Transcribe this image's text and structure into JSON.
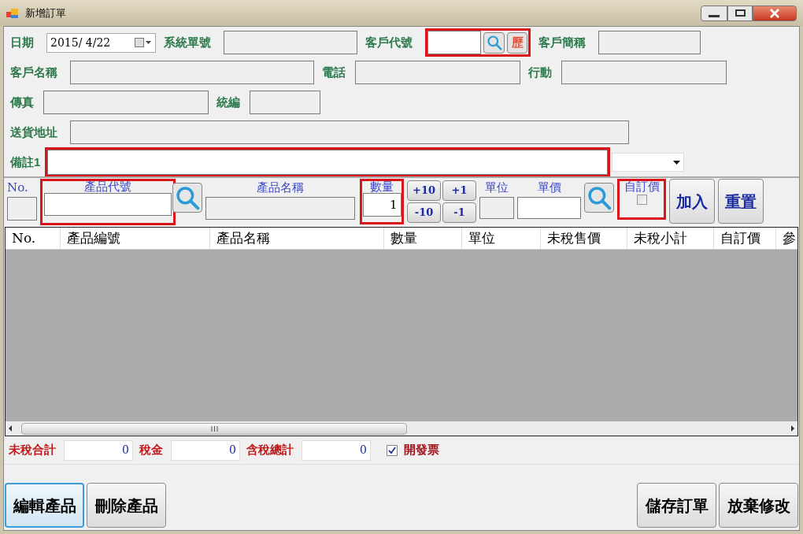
{
  "window": {
    "title": "新增訂單"
  },
  "form_rows": [
    [
      {
        "kind": "date",
        "label": "日期",
        "value": "2015/ 4/22"
      },
      {
        "kind": "field",
        "label": "系統單號",
        "readonly": true,
        "highlighted": false
      },
      {
        "kind": "lookup",
        "label": "客戶代號",
        "history_button": "歷",
        "readonly": false,
        "highlighted": true
      },
      {
        "kind": "field",
        "label": "客戶簡稱",
        "readonly": true,
        "highlighted": false
      }
    ],
    [
      {
        "kind": "field",
        "label": "客戶名稱",
        "readonly": true,
        "highlighted": false
      },
      {
        "kind": "field",
        "label": "電話",
        "readonly": true,
        "highlighted": false
      },
      {
        "kind": "field",
        "label": "行動",
        "readonly": true,
        "highlighted": false
      }
    ],
    [
      {
        "kind": "field",
        "label": "傳真",
        "readonly": true,
        "highlighted": false
      },
      {
        "kind": "field",
        "label": "統編",
        "readonly": true,
        "highlighted": false
      }
    ],
    [
      {
        "kind": "field",
        "label": "送貨地址",
        "readonly": true,
        "highlighted": false
      }
    ],
    [
      {
        "kind": "memo",
        "label": "備註1",
        "readonly": false,
        "highlighted": true
      }
    ]
  ],
  "entry": {
    "no_label": "No.",
    "code": {
      "label": "產品代號",
      "highlighted": true
    },
    "name": {
      "label": "產品名稱"
    },
    "qty": {
      "label": "數量",
      "value": "1",
      "highlighted": true
    },
    "steps": [
      "+10",
      "+1",
      "-10",
      "-1"
    ],
    "unit": {
      "label": "單位"
    },
    "price": {
      "label": "單價"
    },
    "custom_price": {
      "label": "自訂價",
      "checked": false,
      "highlighted": true
    },
    "buttons": [
      "加入",
      "重置"
    ]
  },
  "table": {
    "columns": [
      "No.",
      "產品編號",
      "產品名稱",
      "數量",
      "單位",
      "未稅售價",
      "未稅小計",
      "自訂價",
      "參"
    ]
  },
  "totals": [
    {
      "label": "未稅合計",
      "value": "0"
    },
    {
      "label": "稅金",
      "value": "0"
    },
    {
      "label": "含稅總計",
      "value": "0"
    }
  ],
  "invoice": {
    "label": "開發票",
    "checked": true
  },
  "left_buttons": [
    {
      "label": "編輯產品",
      "focused": true
    },
    {
      "label": "刪除產品",
      "focused": false
    }
  ],
  "right_buttons": [
    {
      "label": "儲存訂單",
      "focused": false
    },
    {
      "label": "放棄修改",
      "focused": false
    }
  ]
}
